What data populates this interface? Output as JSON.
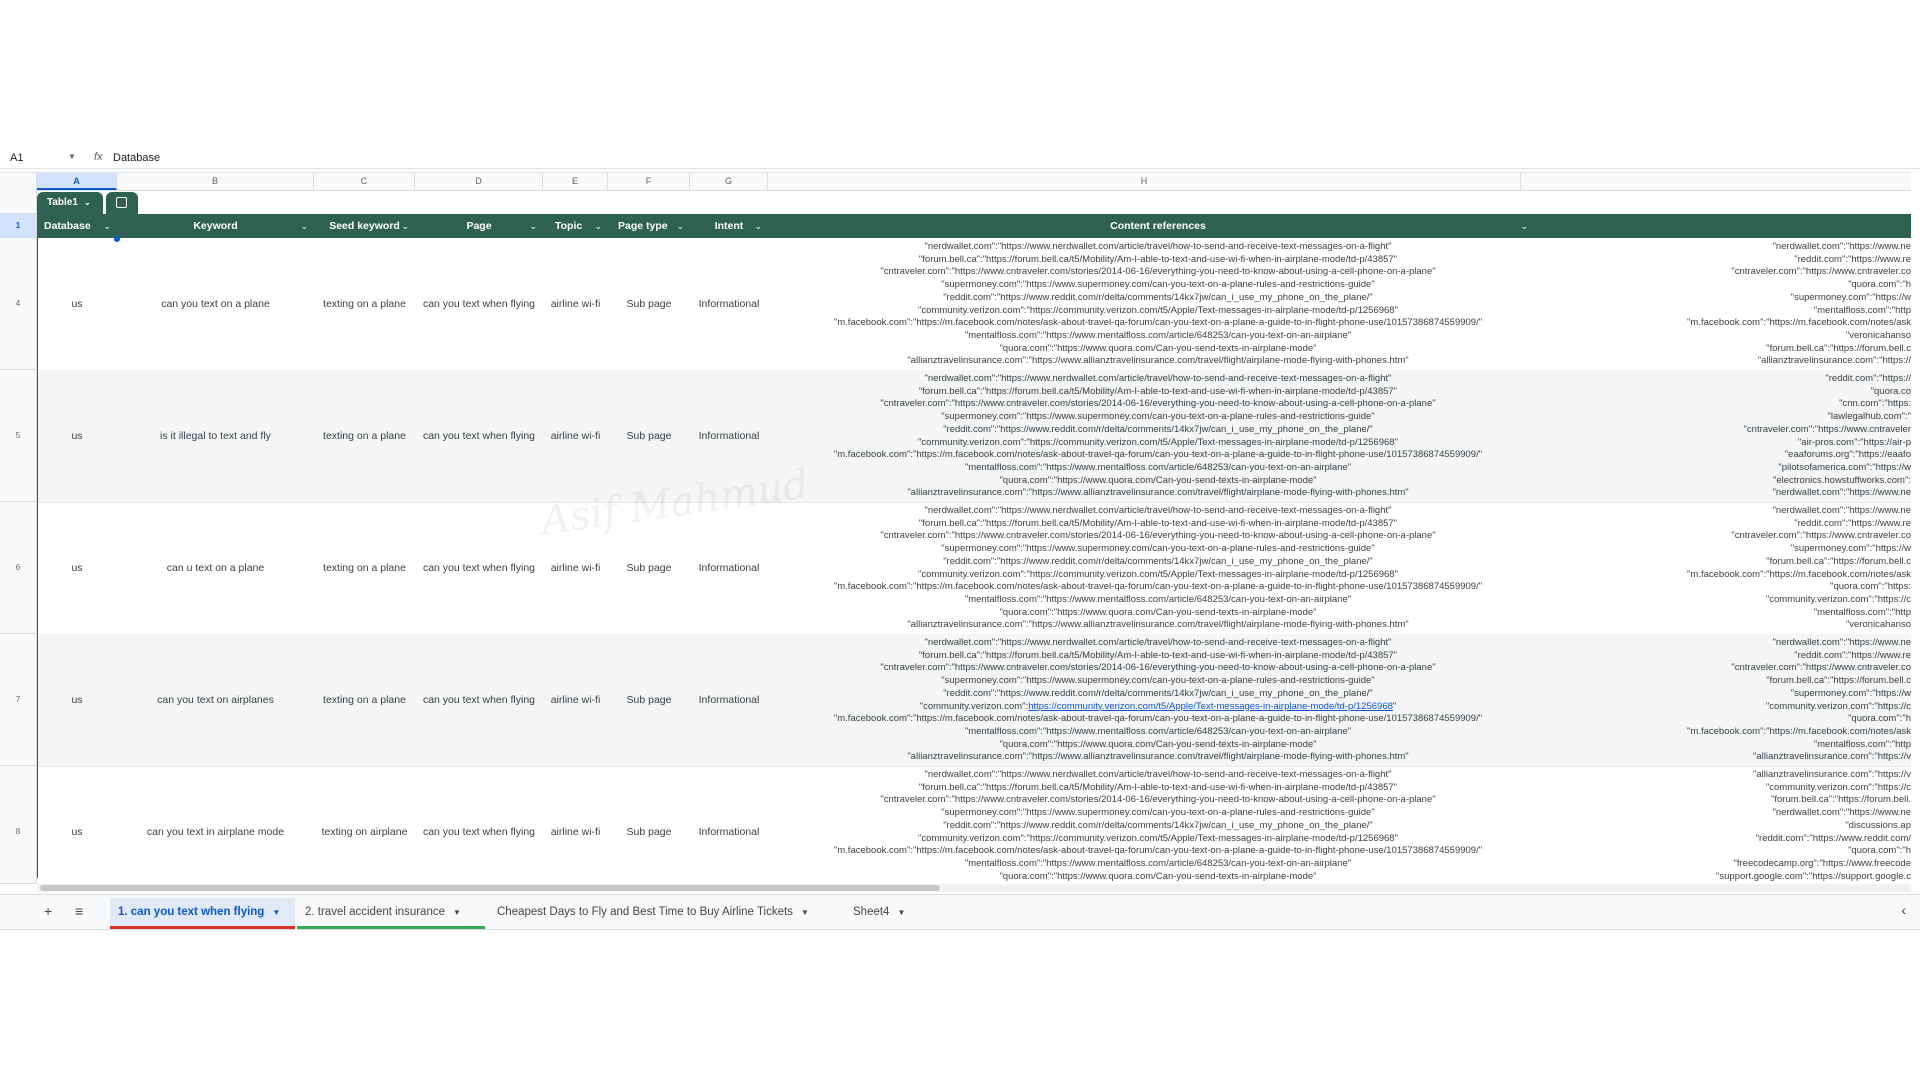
{
  "formula_bar": {
    "cell_ref": "A1",
    "fx": "fx",
    "content": "Database"
  },
  "columns": [
    "A",
    "B",
    "C",
    "D",
    "E",
    "F",
    "G",
    "H"
  ],
  "table": {
    "name": "Table1",
    "headers": [
      "Database",
      "Keyword",
      "Seed keyword",
      "Page",
      "Topic",
      "Page type",
      "Intent",
      "Content references"
    ],
    "header_color": "#2e6152"
  },
  "rows": [
    {
      "num": "4",
      "database": "us",
      "keyword": "can you text on a plane",
      "seed": "texting on a plane",
      "page": "can you text when flying",
      "topic": "airline wi-fi",
      "page_type": "Sub page",
      "intent": "Informational"
    },
    {
      "num": "5",
      "database": "us",
      "keyword": "is it illegal to text and fly",
      "seed": "texting on a plane",
      "page": "can you text when flying",
      "topic": "airline wi-fi",
      "page_type": "Sub page",
      "intent": "Informational"
    },
    {
      "num": "6",
      "database": "us",
      "keyword": "can u text on a plane",
      "seed": "texting on a plane",
      "page": "can you text when flying",
      "topic": "airline wi-fi",
      "page_type": "Sub page",
      "intent": "Informational"
    },
    {
      "num": "7",
      "database": "us",
      "keyword": "can you text on airplanes",
      "seed": "texting on a plane",
      "page": "can you text when flying",
      "topic": "airline wi-fi",
      "page_type": "Sub page",
      "intent": "Informational"
    },
    {
      "num": "8",
      "database": "us",
      "keyword": "can you text in airplane mode",
      "seed": "texting on airplane",
      "page": "can you text when flying",
      "topic": "airline wi-fi",
      "page_type": "Sub page",
      "intent": "Informational"
    }
  ],
  "refs": [
    "\"nerdwallet.com\":\"https://www.nerdwallet.com/article/travel/how-to-send-and-receive-text-messages-on-a-flight\"",
    "\"forum.bell.ca\":\"https://forum.bell.ca/t5/Mobility/Am-I-able-to-text-and-use-wi-fi-when-in-airplane-mode/td-p/43857\"",
    "\"cntraveler.com\":\"https://www.cntraveler.com/stories/2014-06-16/everything-you-need-to-know-about-using-a-cell-phone-on-a-plane\"",
    "\"supermoney.com\":\"https://www.supermoney.com/can-you-text-on-a-plane-rules-and-restrictions-guide\"",
    "\"reddit.com\":\"https://www.reddit.com/r/delta/comments/14kx7jw/can_i_use_my_phone_on_the_plane/\"",
    "\"community.verizon.com\":\"https://community.verizon.com/t5/Apple/Text-messages-in-airplane-mode/td-p/1256968\"",
    "\"m.facebook.com\":\"https://m.facebook.com/notes/ask-about-travel-qa-forum/can-you-text-on-a-plane-a-guide-to-in-flight-phone-use/10157386874559909/\"",
    "\"mentalfloss.com\":\"https://www.mentalfloss.com/article/648253/can-you-text-on-an-airplane\"",
    "\"quora.com\":\"https://www.quora.com/Can-you-send-texts-in-airplane-mode\"",
    "\"allianztravelinsurance.com\":\"https://www.allianztravelinsurance.com/travel/flight/airplane-mode-flying-with-phones.htm\""
  ],
  "verizon_label": "\"community.verizon.com\":",
  "verizon_link": "https://community.verizon.com/t5/Apple/Text-messages-in-airplane-mode/td-p/1256968",
  "refs_row5_col2": [
    "\"reddit.com\":\"https://",
    "\"quora.co",
    "\"cnn.com\":\"https:",
    "\"lawlegalhub.com\":\"",
    "\"cntraveler.com\":\"https://www.cntraveler",
    "\"air-pros.com\":\"https://air-p",
    "\"eaaforums.org\":\"https://eaafo",
    "\"pilotsofamerica.com\":\"https://w",
    "\"electronics.howstuffworks.com\":",
    "\"nerdwallet.com\":\"https://www.ne"
  ],
  "refs_row4_col2": [
    "\"nerdwallet.com\":\"https://www.ne",
    "\"reddit.com\":\"https://www.re",
    "\"cntraveler.com\":\"https://www.cntraveler.co",
    "\"quora.com\":\"h",
    "\"supermoney.com\":\"https://w",
    "\"mentalfloss.com\":\"http",
    "\"m.facebook.com\":\"https://m.facebook.com/notes/ask",
    "\"veronicahanso",
    "\"forum.bell.ca\":\"https://forum.bell.c",
    "\"allianztravelinsurance.com\":\"https://"
  ],
  "refs_row6_col2": [
    "\"nerdwallet.com\":\"https://www.ne",
    "\"reddit.com\":\"https://www.re",
    "\"cntraveler.com\":\"https://www.cntraveler.co",
    "\"supermoney.com\":\"https://w",
    "\"forum.bell.ca\":\"https://forum.bell.c",
    "\"m.facebook.com\":\"https://m.facebook.com/notes/ask",
    "\"quora.com\":\"https:",
    "\"community.verizon.com\":\"https://c",
    "\"mentalfloss.com\":\"http",
    "\"veronicahanso"
  ],
  "refs_row7_col2": [
    "\"nerdwallet.com\":\"https://www.ne",
    "\"reddit.com\":\"https://www.re",
    "\"cntraveler.com\":\"https://www.cntraveler.co",
    "\"forum.bell.ca\":\"https://forum.bell.c",
    "\"supermoney.com\":\"https://w",
    "\"community.verizon.com\":\"https://c",
    "\"quora.com\":\"h",
    "\"m.facebook.com\":\"https://m.facebook.com/notes/ask",
    "\"mentalfloss.com\":\"http",
    "\"allianztravelinsurance.com\":\"https://v"
  ],
  "refs_row8_col2": [
    "\"allianztravelinsurance.com\":\"https://v",
    "\"community.verizon.com\":\"https://c",
    "\"forum.bell.ca\":\"https://forum.bell.",
    "\"nerdwallet.com\":\"https://www.ne",
    "\"discussions.ap",
    "\"reddit.com\":\"https://www.reddit.com/",
    "\"quora.com\":\"h",
    "\"freecodecamp.org\":\"https://www.freecode",
    "\"support.google.com\":\"https://support.google.c"
  ],
  "refs_row8": [
    "\"nerdwallet.com\":\"https://www.nerdwallet.com/article/travel/how-to-send-and-receive-text-messages-on-a-flight\"",
    "\"forum.bell.ca\":\"https://forum.bell.ca/t5/Mobility/Am-I-able-to-text-and-use-wi-fi-when-in-airplane-mode/td-p/43857\"",
    "\"cntraveler.com\":\"https://www.cntraveler.com/stories/2014-06-16/everything-you-need-to-know-about-using-a-cell-phone-on-a-plane\"",
    "\"supermoney.com\":\"https://www.supermoney.com/can-you-text-on-a-plane-rules-and-restrictions-guide\"",
    "\"reddit.com\":\"https://www.reddit.com/r/delta/comments/14kx7jw/can_i_use_my_phone_on_the_plane/\"",
    "\"community.verizon.com\":\"https://community.verizon.com/t5/Apple/Text-messages-in-airplane-mode/td-p/1256968\"",
    "\"m.facebook.com\":\"https://m.facebook.com/notes/ask-about-travel-qa-forum/can-you-text-on-a-plane-a-guide-to-in-flight-phone-use/10157386874559909/\"",
    "\"mentalfloss.com\":\"https://www.mentalfloss.com/article/648253/can-you-text-on-an-airplane\"",
    "\"quora.com\":\"https://www.quora.com/Can-you-send-texts-in-airplane-mode\""
  ],
  "sheet_tabs": [
    {
      "label": "1. can you text when flying",
      "underline": "#d93025"
    },
    {
      "label": "2. travel accident insurance",
      "underline": "#34a853"
    },
    {
      "label": "Cheapest Days to Fly and Best Time to Buy Airline Tickets",
      "underline": ""
    },
    {
      "label": "Sheet4",
      "underline": ""
    }
  ],
  "icons": {
    "add": "plus-icon",
    "all_sheets": "list-icon",
    "collapse": "chevron-left-icon"
  },
  "watermark": "Asif Mahmud"
}
